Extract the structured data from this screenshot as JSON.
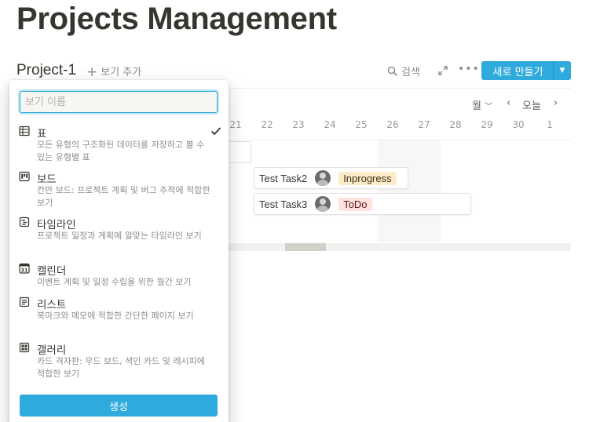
{
  "page": {
    "title": "Projects Management"
  },
  "database": {
    "title": "Project-1",
    "add_view_label": "보기 추가"
  },
  "toolbar": {
    "search_label": "검색",
    "more_label": "•••",
    "new_label": "새로 만들기"
  },
  "timeline": {
    "scale_label": "월",
    "today_label": "오늘",
    "dates": [
      "21",
      "22",
      "23",
      "24",
      "25",
      "26",
      "27",
      "28",
      "29",
      "30",
      "1"
    ],
    "tasks": [
      {
        "name": "Test Task2",
        "status": "Inprogress"
      },
      {
        "name": "Test Task3",
        "status": "ToDo"
      }
    ]
  },
  "view_popup": {
    "name_placeholder": "보기 이름",
    "options": [
      {
        "title": "표",
        "desc": "모든 유형의 구조화된 데이터를 저장하고 볼 수 있는 유형별 표",
        "icon": "table-icon",
        "selected": true
      },
      {
        "title": "보드",
        "desc": "칸반 보드: 프로젝트 계획 및 버그 추적에 적합한 보기",
        "icon": "board-icon"
      },
      {
        "title": "타임라인",
        "desc": "프로젝트 일정과 계획에 알맞는 타임라인 보기",
        "icon": "timeline-icon"
      },
      {
        "title": "캘린더",
        "desc": "이벤트 계획 및 일정 수립을 위한 월간 보기",
        "icon": "calendar-icon"
      },
      {
        "title": "리스트",
        "desc": "북마크와 메모에 적합한 간단한 페이지 보기",
        "icon": "list-icon"
      },
      {
        "title": "갤러리",
        "desc": "카드 격자판: 무드 보드, 색인 카드 및 레시피에 적합한 보기",
        "icon": "gallery-icon"
      }
    ],
    "create_label": "생성"
  },
  "colors": {
    "accent": "#2eaadc",
    "tag_inprogress": "#fdecc8",
    "tag_todo": "#ffe2dd"
  }
}
